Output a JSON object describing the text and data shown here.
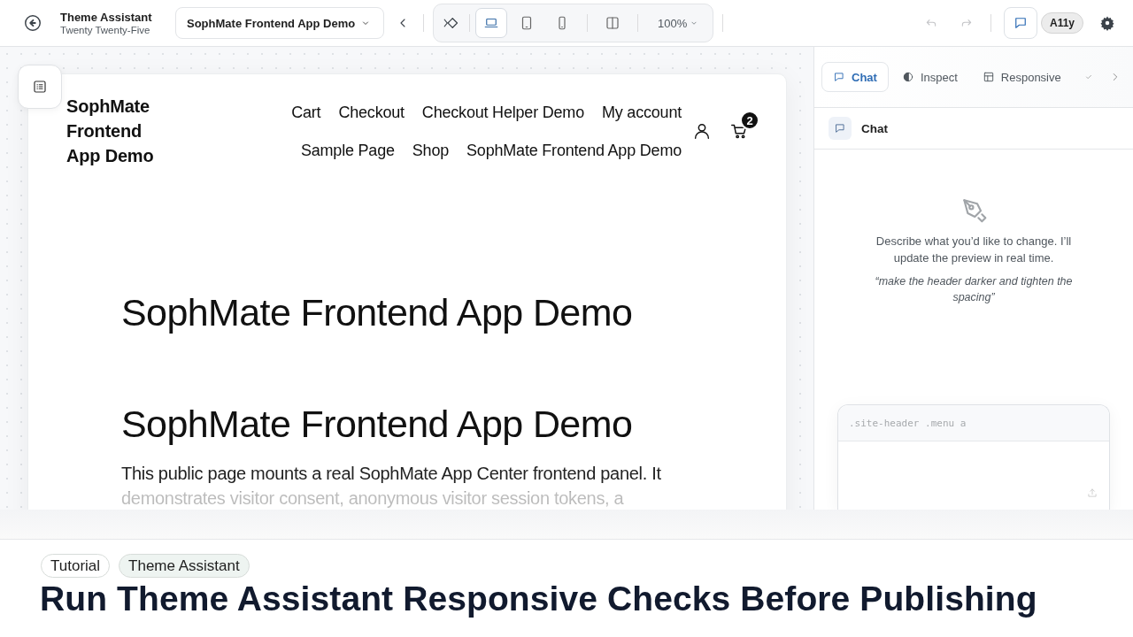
{
  "toolbar": {
    "app_title": "Theme Assistant",
    "app_subtitle": "Twenty Twenty-Five",
    "page_select": "SophMate Frontend App Demo",
    "devices": [
      {
        "kind": "desktop",
        "selected": true
      },
      {
        "kind": "tablet",
        "selected": false
      },
      {
        "kind": "mobile",
        "selected": false
      }
    ],
    "zoom": "100%",
    "undo_disabled": true,
    "redo_disabled": true,
    "chat_toggle_on": true,
    "a11y": "A11y"
  },
  "preview": {
    "site_title": "SophMate Frontend App Demo",
    "nav_rows": [
      [
        "Cart",
        "Checkout",
        "Checkout Helper Demo",
        "My account"
      ],
      [
        "Sample Page",
        "Shop",
        "SophMate Frontend App Demo"
      ]
    ],
    "cart_count": "2",
    "headings": [
      "SophMate Frontend App Demo",
      "SophMate Frontend App Demo"
    ],
    "paragraph": "This public page mounts a real SophMate App Center frontend panel. It demonstrates visitor consent, anonymous visitor session tokens, a"
  },
  "panel": {
    "tabs": [
      {
        "label": "Chat",
        "kind": "chat",
        "selected": true
      },
      {
        "label": "Inspect",
        "kind": "inspect",
        "selected": false
      },
      {
        "label": "Responsive",
        "kind": "responsive",
        "selected": false
      }
    ],
    "section_title": "Chat",
    "empty_text": "Describe what you’d like to change. I’ll update the preview in real time.",
    "example": "“make the header darker and tighten the spacing”",
    "selector_placeholder": ".site-header .menu a"
  },
  "article": {
    "tags": [
      {
        "label": "Tutorial",
        "color": "#ffffff"
      },
      {
        "label": "Theme Assistant",
        "color": "#eef4f1"
      }
    ],
    "title": "Run Theme Assistant Responsive Checks Before Publishing"
  }
}
